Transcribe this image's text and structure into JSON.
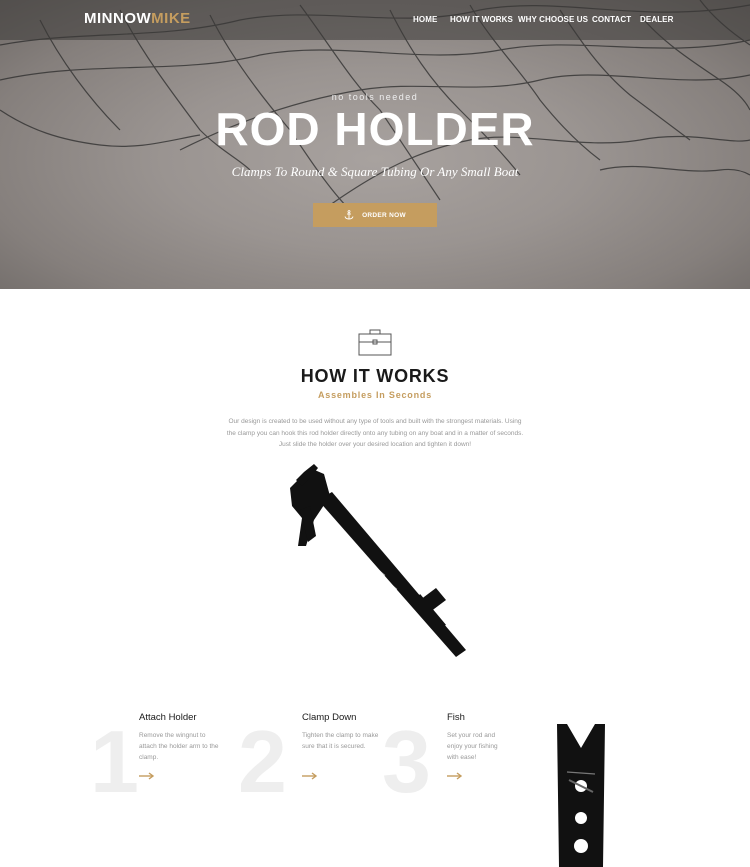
{
  "brand": {
    "name_part1": "MINNOW",
    "name_part2": "MIKE",
    "accent_color": "#c59d5f"
  },
  "nav": {
    "items": [
      {
        "label": "HOME"
      },
      {
        "label": "HOW IT WORKS"
      },
      {
        "label": "WHY CHOOSE US"
      },
      {
        "label": "CONTACT"
      },
      {
        "label": "DEALER"
      }
    ]
  },
  "hero": {
    "kicker": "no tools needed",
    "title": "ROD HOLDER",
    "subtitle": "Clamps To Round & Square Tubing Or Any Small Boat",
    "button_label": "ORDER NOW",
    "button_icon": "anchor-icon"
  },
  "how_it_works": {
    "icon": "toolbox-icon",
    "title": "HOW IT WORKS",
    "subtitle": "Assembles In Seconds",
    "description": "Our design is created to be used without any type of tools and built with the strongest materials. Using the clamp you can hook this rod holder directly onto any tubing on any boat and in a matter of seconds. Just slide the holder over your desired location and tighten it down!"
  },
  "steps": [
    {
      "number": "1",
      "title": "Attach Holder",
      "text": "Remove the wingnut to attach the holder arm to the clamp."
    },
    {
      "number": "2",
      "title": "Clamp Down",
      "text": "Tighten the clamp to make sure that it is secured."
    },
    {
      "number": "3",
      "title": "Fish",
      "text": "Set your rod and enjoy your fishing with ease!"
    }
  ]
}
